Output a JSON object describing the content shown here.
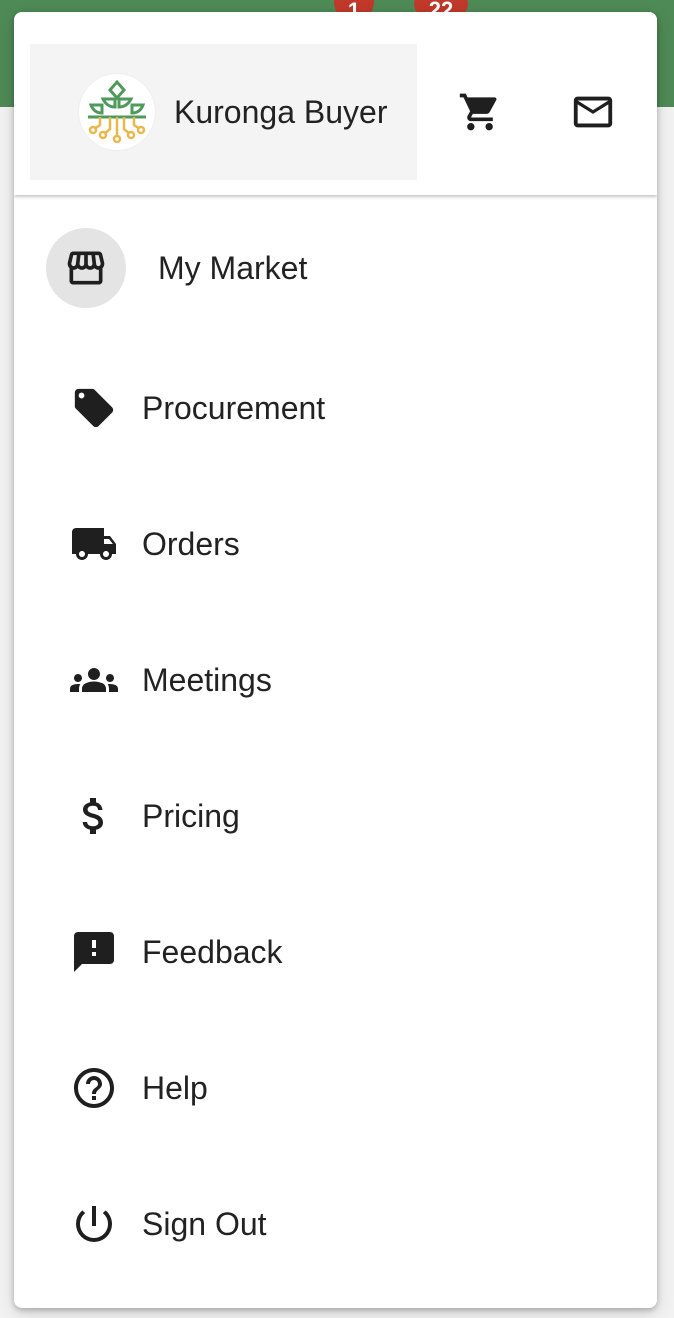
{
  "header": {
    "profile_name": "Kuronga Buyer",
    "avatar_icon": "kuronga-logo",
    "cart_icon": "shopping-cart-icon",
    "mail_icon": "mail-icon"
  },
  "badges": {
    "cart_count": "1",
    "mail_count": "22"
  },
  "menu": {
    "items": [
      {
        "label": "My Market",
        "icon": "storefront-icon",
        "active": true
      },
      {
        "label": "Procurement",
        "icon": "tag-icon"
      },
      {
        "label": "Orders",
        "icon": "truck-icon"
      },
      {
        "label": "Meetings",
        "icon": "groups-icon"
      },
      {
        "label": "Pricing",
        "icon": "dollar-icon"
      },
      {
        "label": "Feedback",
        "icon": "feedback-icon"
      },
      {
        "label": "Help",
        "icon": "help-icon"
      },
      {
        "label": "Sign Out",
        "icon": "power-icon"
      }
    ]
  },
  "colors": {
    "app_bar": "#4e8a56",
    "badge": "#c0392b",
    "logo_green": "#4f9a5b",
    "logo_gold": "#e8b84a"
  }
}
